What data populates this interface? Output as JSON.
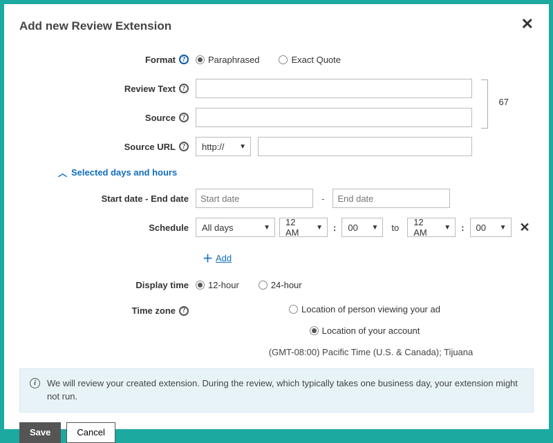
{
  "dialog": {
    "title": "Add new Review Extension",
    "close": "✕"
  },
  "labels": {
    "format": "Format",
    "review_text": "Review Text",
    "source": "Source",
    "source_url": "Source URL",
    "start_end": "Start date - End date",
    "schedule": "Schedule",
    "display_time": "Display time",
    "time_zone": "Time zone"
  },
  "format": {
    "paraphrased": "Paraphrased",
    "exact_quote": "Exact Quote",
    "selected": "paraphrased"
  },
  "char_count": "67",
  "url_protocol": "http://",
  "section_toggle": "Selected days and hours",
  "date": {
    "start_placeholder": "Start date",
    "end_placeholder": "End date"
  },
  "schedule": {
    "days": "All days",
    "time1": "12 AM",
    "min1": "00",
    "to": "to",
    "time2": "12 AM",
    "min2": "00",
    "add": "Add"
  },
  "display_time": {
    "h12": "12-hour",
    "h24": "24-hour",
    "selected": "12"
  },
  "time_zone": {
    "viewer": "Location of person viewing your ad",
    "account": "Location of your account",
    "account_detail": "(GMT-08:00) Pacific Time (U.S. & Canada); Tijuana",
    "selected": "account"
  },
  "info": "We will review your created extension. During the review, which typically takes one business day, your extension might not run.",
  "buttons": {
    "save": "Save",
    "cancel": "Cancel"
  }
}
